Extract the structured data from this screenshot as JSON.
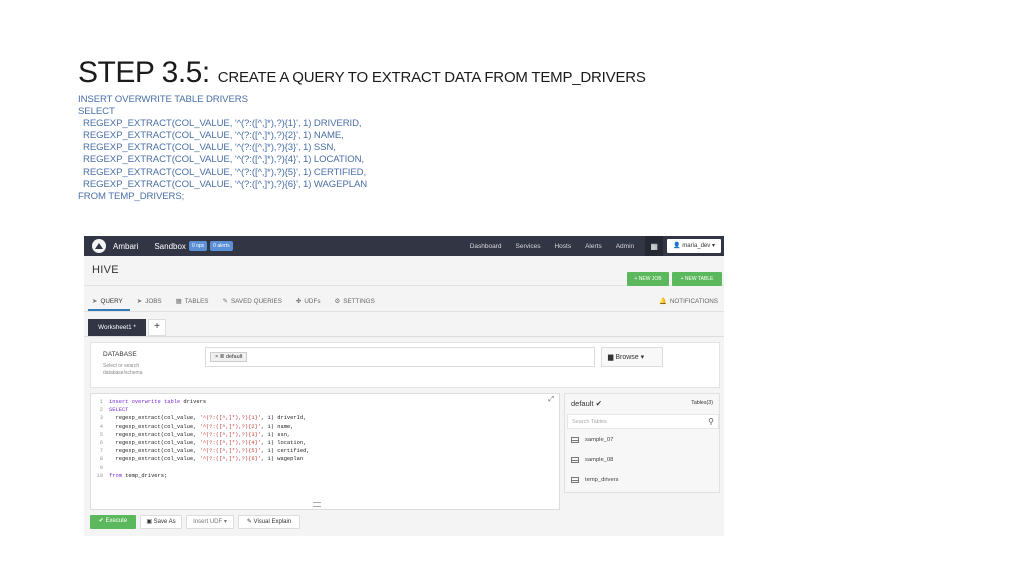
{
  "slide": {
    "title_big": "STEP 3.5:",
    "title_small": "CREATE A QUERY TO EXTRACT DATA FROM TEMP_DRIVERS",
    "lines": [
      "INSERT OVERWRITE TABLE DRIVERS",
      "SELECT",
      "REGEXP_EXTRACT(COL_VALUE, '^(?:([^,]*),?){1}', 1) DRIVERID,",
      "REGEXP_EXTRACT(COL_VALUE, '^(?:([^,]*),?){2}', 1) NAME,",
      "REGEXP_EXTRACT(COL_VALUE, '^(?:([^,]*),?){3}', 1) SSN,",
      "REGEXP_EXTRACT(COL_VALUE, '^(?:([^,]*),?){4}', 1) LOCATION,",
      "REGEXP_EXTRACT(COL_VALUE, '^(?:([^,]*),?){5}', 1) CERTIFIED,",
      "REGEXP_EXTRACT(COL_VALUE, '^(?:([^,]*),?){6}', 1) WAGEPLAN",
      "FROM TEMP_DRIVERS;"
    ]
  },
  "app": {
    "brand": "Ambari",
    "cluster": "Sandbox",
    "badge_ops": "0 ops",
    "badge_alerts": "0 alerts",
    "nav": [
      "Dashboard",
      "Services",
      "Hosts",
      "Alerts",
      "Admin"
    ],
    "user": "maria_dev",
    "view_title": "HIVE",
    "new_job": "+ NEW JOB",
    "new_table": "+ NEW TABLE"
  },
  "tabs": [
    {
      "label": "QUERY",
      "icon": "send-icon"
    },
    {
      "label": "JOBS",
      "icon": "send-icon"
    },
    {
      "label": "TABLES",
      "icon": "table-icon"
    },
    {
      "label": "SAVED QUERIES",
      "icon": "tag-icon"
    },
    {
      "label": "UDFs",
      "icon": "puzzle-icon"
    },
    {
      "label": "SETTINGS",
      "icon": "gear-icon"
    }
  ],
  "notifications": "NOTIFICATIONS",
  "worksheet": {
    "tab_label": "Worksheet1 *",
    "add_label": "+"
  },
  "database": {
    "label": "DATABASE",
    "hint": "Select or search database/schema",
    "chip": "default",
    "browse": "Browse"
  },
  "editor": {
    "lines": [
      {
        "n": "1",
        "kw": "insert overwrite table",
        "rest": " drivers",
        "s": "",
        "tail": ""
      },
      {
        "n": "2",
        "kw": "SELECT",
        "rest": "",
        "s": "",
        "tail": ""
      },
      {
        "n": "3",
        "kw": "",
        "rest": "  regexp_extract(col_value, ",
        "s": "'^(?:([^,]*),?){1}'",
        "tail": ", 1) driverId,"
      },
      {
        "n": "4",
        "kw": "",
        "rest": "  regexp_extract(col_value, ",
        "s": "'^(?:([^,]*),?){2}'",
        "tail": ", 1) name,"
      },
      {
        "n": "5",
        "kw": "",
        "rest": "  regexp_extract(col_value, ",
        "s": "'^(?:([^,]*),?){3}'",
        "tail": ", 1) ssn,"
      },
      {
        "n": "6",
        "kw": "",
        "rest": "  regexp_extract(col_value, ",
        "s": "'^(?:([^,]*),?){4}'",
        "tail": ", 1) location,"
      },
      {
        "n": "7",
        "kw": "",
        "rest": "  regexp_extract(col_value, ",
        "s": "'^(?:([^,]*),?){5}'",
        "tail": ", 1) certified,"
      },
      {
        "n": "8",
        "kw": "",
        "rest": "  regexp_extract(col_value, ",
        "s": "'^(?:([^,]*),?){6}'",
        "tail": ", 1) wageplan"
      },
      {
        "n": "9",
        "kw": "",
        "rest": "",
        "s": "",
        "tail": ""
      },
      {
        "n": "10",
        "kw": "from",
        "rest": " temp_drivers;",
        "s": "",
        "tail": ""
      }
    ]
  },
  "side": {
    "db": "default",
    "count": "Tables(3)",
    "search_placeholder": "Search Tables",
    "tables": [
      "sample_07",
      "sample_08",
      "temp_drivers"
    ]
  },
  "actions": {
    "execute": "Execute",
    "save_as": "Save As",
    "insert_udf": "Insert UDF",
    "visual_explain": "Visual Explain"
  },
  "colors": {
    "topbar": "#323544",
    "accent_green": "#5cb85c",
    "accent_blue": "#337ab7",
    "keyword": "#7a2ed6",
    "string": "#c43a3a",
    "slide_sql": "#4a6fa5"
  }
}
